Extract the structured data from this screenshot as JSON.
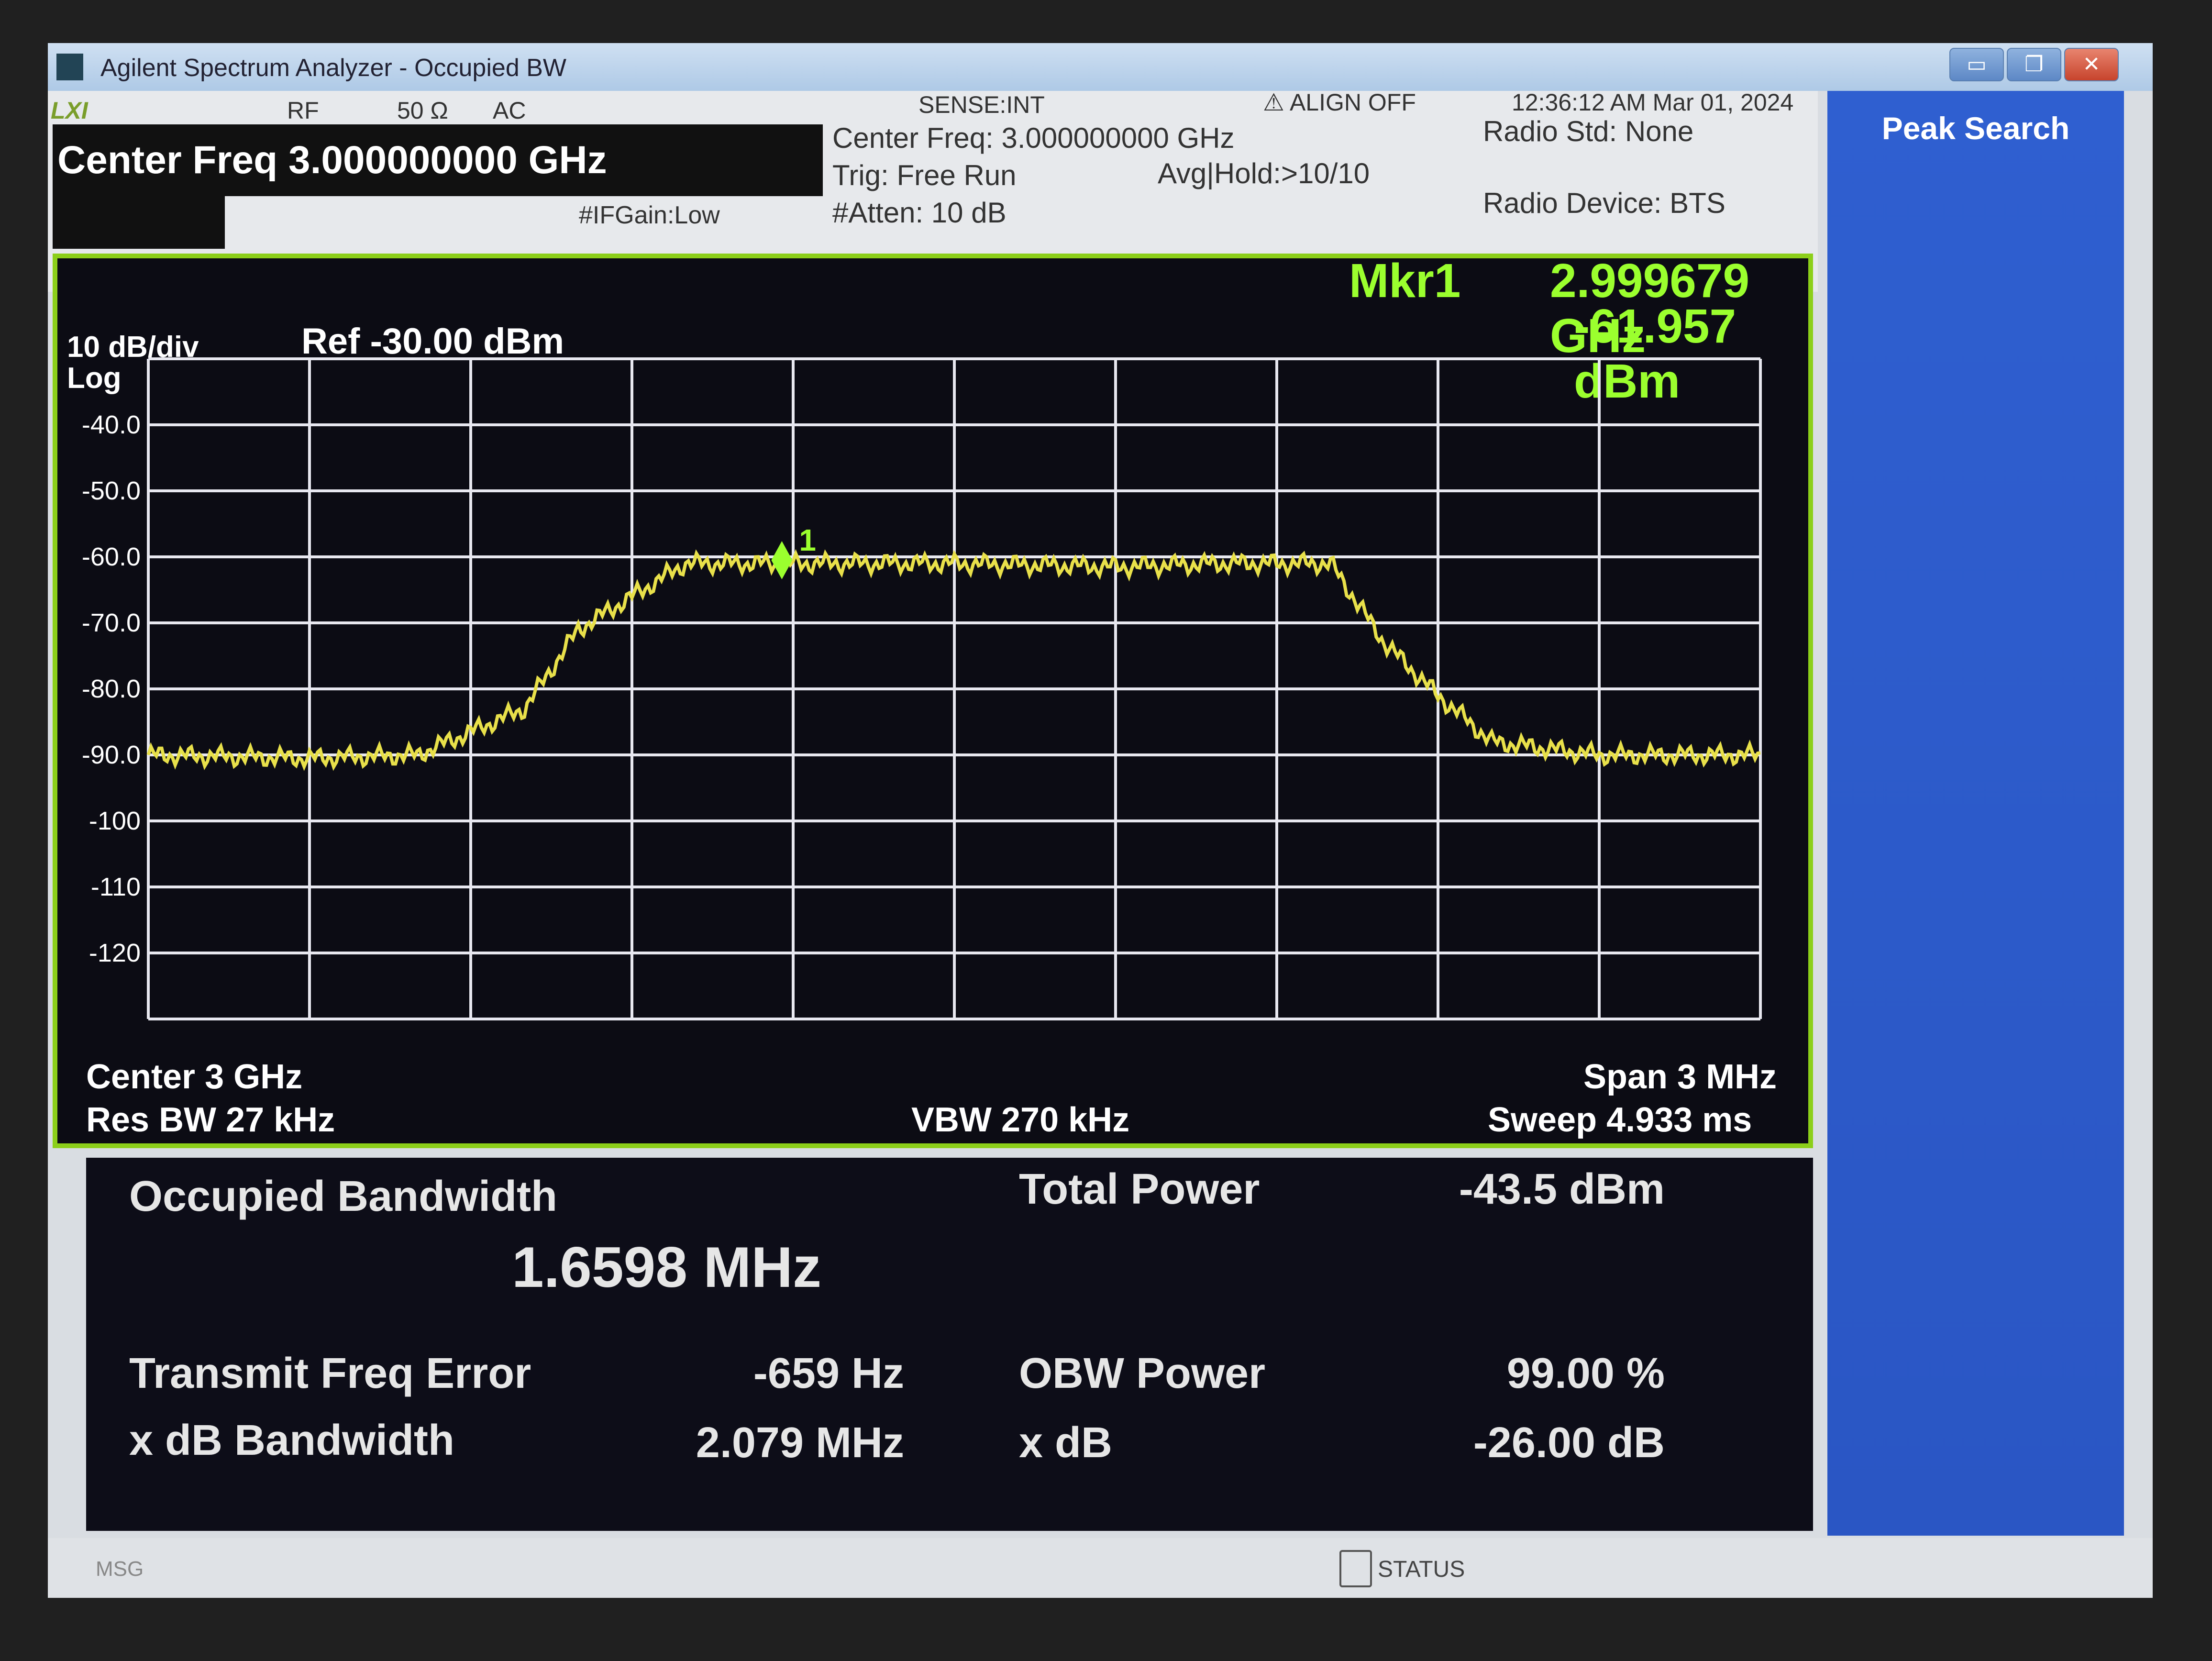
{
  "window": {
    "title": "Agilent Spectrum Analyzer - Occupied BW",
    "minimize_glyph": "▭",
    "maximize_glyph": "❐",
    "close_glyph": "✕"
  },
  "status_header": {
    "lxi": "LXI",
    "rf": "RF",
    "impedance": "50 Ω",
    "coupling": "AC",
    "sense": "SENSE:INT",
    "align": "⚠ ALIGN OFF",
    "datetime": "12:36:12 AM Mar 01, 2024",
    "center_freq_entry": "Center Freq 3.000000000 GHz",
    "ifgain": "#IFGain:Low",
    "center_freq_info": "Center Freq: 3.000000000 GHz",
    "trig": "Trig: Free Run",
    "atten": "#Atten: 10 dB",
    "avg_hold": "Avg|Hold:>10/10",
    "radio_std": "Radio Std: None",
    "radio_device": "Radio Device: BTS"
  },
  "softkeys": {
    "title": "Peak Search"
  },
  "graph": {
    "scale": "10 dB/div",
    "scale_type": "Log",
    "ref": "Ref -30.00 dBm",
    "marker_label": "Mkr1",
    "marker_freq": "2.999679 GHz",
    "marker_level": "-61.957 dBm",
    "marker_number": "1",
    "center": "Center  3 GHz",
    "res_bw": "Res BW  27 kHz",
    "vbw": "VBW  270 kHz",
    "span": "Span 3 MHz",
    "sweep": "Sweep  4.933 ms",
    "trace_color": "#e8e04a",
    "grid_color": "#e8e8f0",
    "accent_color": "#9bff2e"
  },
  "chart_data": {
    "type": "line",
    "y_tick_labels": [
      "-40.0",
      "-50.0",
      "-60.0",
      "-70.0",
      "-80.0",
      "-90.0",
      "-100",
      "-110",
      "-120"
    ],
    "ylim": [
      -130,
      -30
    ],
    "xlim": [
      2998.5,
      3001.5
    ],
    "x_unit": "MHz",
    "y_unit": "dBm",
    "grid": true,
    "series": [
      {
        "values_x": [
          2998.5,
          2998.8,
          2999.0,
          2999.2,
          2999.3,
          2999.5,
          2999.7,
          3000.0,
          3000.3,
          3000.5,
          3000.7,
          3000.8,
          3000.9,
          3001.0,
          3001.2,
          3001.5
        ],
        "values_y": [
          -90,
          -90.5,
          -90,
          -83,
          -71,
          -61,
          -61,
          -61,
          -61.5,
          -61,
          -61,
          -73,
          -81,
          -88,
          -90,
          -90
        ]
      }
    ],
    "marker": {
      "x": 2999.679,
      "y": -61.957
    }
  },
  "results": {
    "obw_label": "Occupied Bandwidth",
    "obw_value": "1.6598 MHz",
    "total_power_label": "Total Power",
    "total_power_value": "-43.5 dBm",
    "tx_freq_error_label": "Transmit Freq Error",
    "tx_freq_error_value": "-659 Hz",
    "obw_power_label": "OBW Power",
    "obw_power_value": "99.00 %",
    "xdb_bw_label": "x dB Bandwidth",
    "xdb_bw_value": "2.079 MHz",
    "xdb_label": "x dB",
    "xdb_value": "-26.00 dB"
  },
  "statusbar": {
    "msg": "MSG",
    "status": "STATUS"
  }
}
